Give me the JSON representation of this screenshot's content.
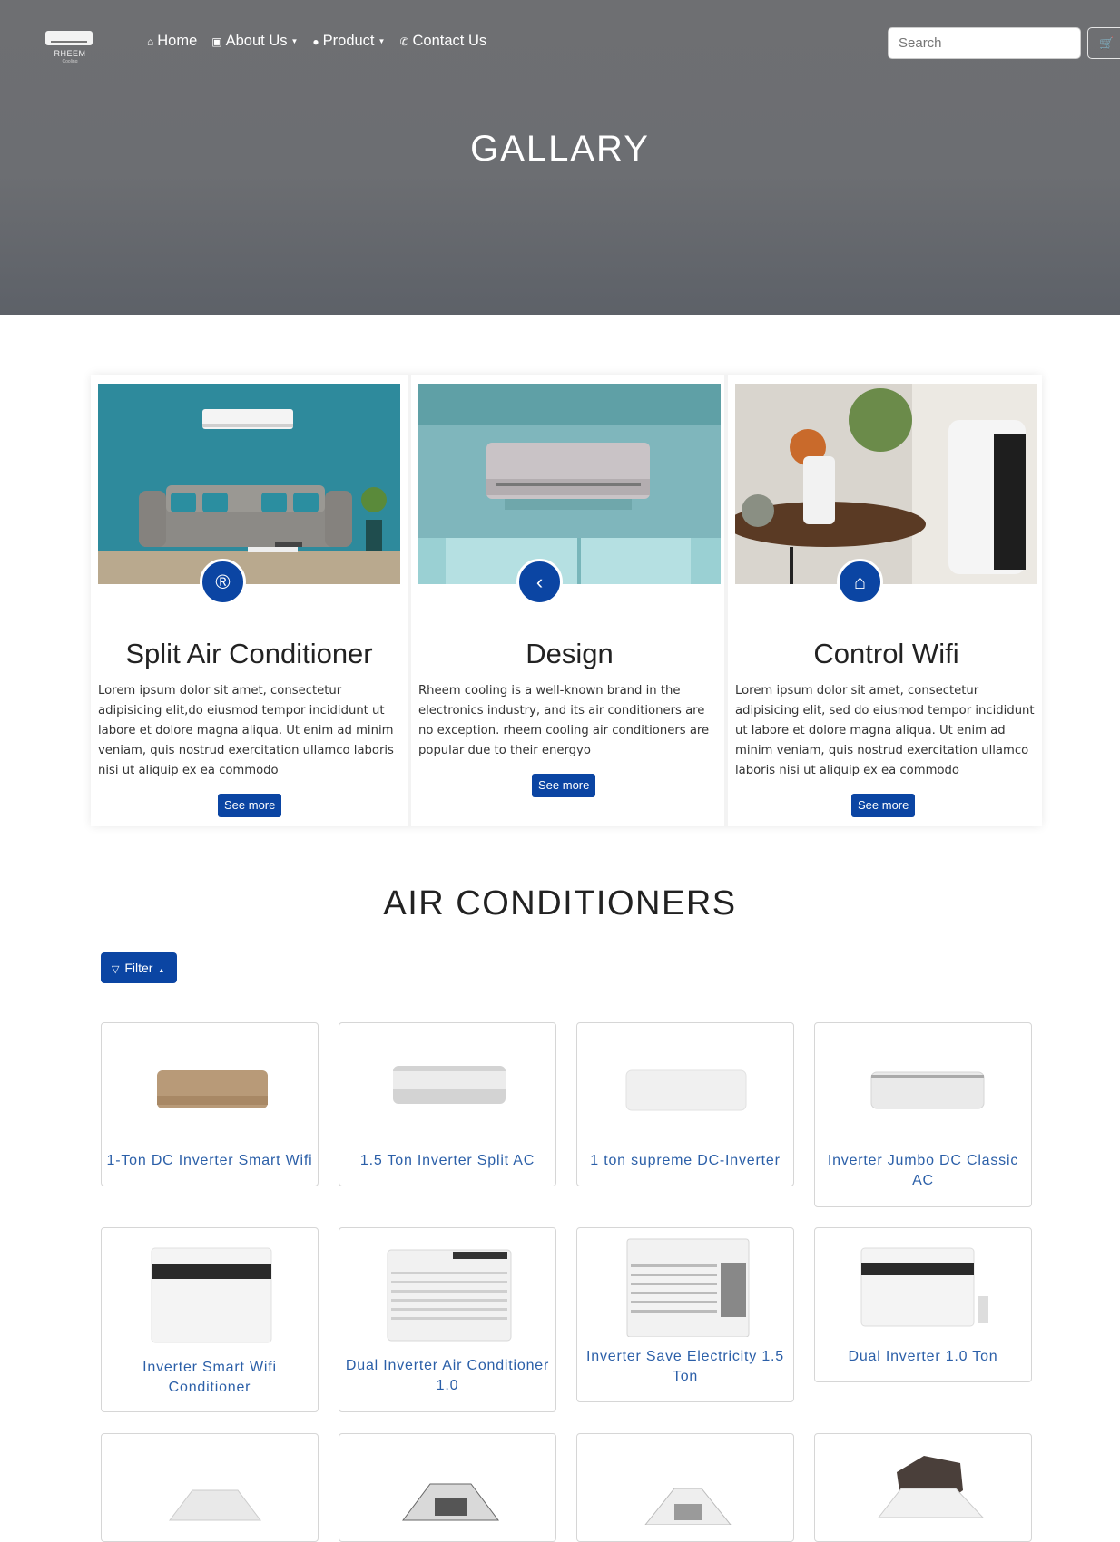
{
  "header": {
    "logo_text": "RHEEM",
    "logo_sub": "Cooling",
    "nav": [
      {
        "label": "Home",
        "icon": "home-icon"
      },
      {
        "label": "About Us",
        "icon": "contact-card-icon"
      },
      {
        "label": "Product",
        "icon": "product-circle-icon"
      },
      {
        "label": "Contact Us",
        "icon": "phone-icon"
      }
    ],
    "search_placeholder": "Search",
    "cart_icon": "cart-icon"
  },
  "hero": {
    "title": "GALLARY"
  },
  "features": [
    {
      "title": "Split Air Conditioner",
      "badge_icon": "registered-icon",
      "text": "Lorem ipsum dolor sit amet, consectetur adipisicing elit,do eiusmod tempor incididunt ut labore et dolore magna aliqua. Ut enim ad minim veniam, quis nostrud exercitation ullamco laboris nisi ut aliquip ex ea commodo",
      "button": "See more"
    },
    {
      "title": "Design",
      "badge_icon": "flutter-icon",
      "text": "Rheem cooling is a well-known brand in the electronics industry, and its air conditioners are no exception. rheem cooling air conditioners are popular due to their energyo",
      "button": "See more"
    },
    {
      "title": "Control Wifi",
      "badge_icon": "toolbox-icon",
      "text": "Lorem ipsum dolor sit amet, consectetur adipisicing elit, sed do eiusmod tempor incididunt ut labore et dolore magna aliqua. Ut enim ad minim veniam, quis nostrud exercitation ullamco laboris nisi ut aliquip ex ea commodo",
      "button": "See more"
    }
  ],
  "products_section": {
    "title": "AIR CONDITIONERS",
    "filter_label": "Filter",
    "items": [
      {
        "name": "1-Ton DC Inverter Smart Wifi"
      },
      {
        "name": "1.5 Ton Inverter Split AC"
      },
      {
        "name": "1 ton supreme DC-Inverter"
      },
      {
        "name": "Inverter Jumbo DC Classic AC"
      },
      {
        "name": "Inverter Smart Wifi Conditioner"
      },
      {
        "name": "Dual Inverter Air Conditioner 1.0"
      },
      {
        "name": "Inverter Save Electricity 1.5 Ton"
      },
      {
        "name": "Dual Inverter 1.0 Ton"
      }
    ]
  },
  "colors": {
    "hero_gray": "#6d6e72",
    "brand_blue": "#0b45a3",
    "product_name_blue": "#2b5fa8"
  }
}
